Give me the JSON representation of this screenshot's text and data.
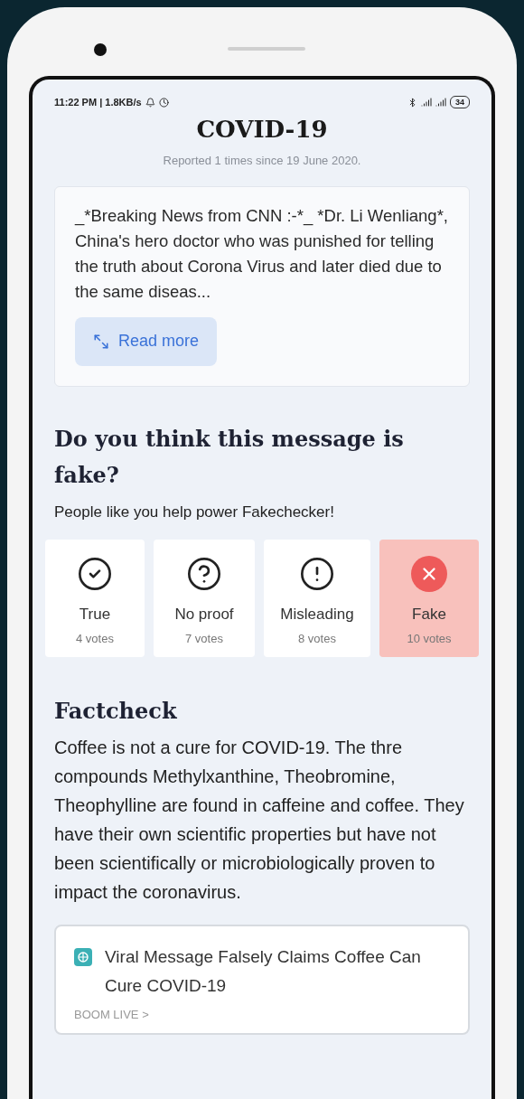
{
  "status_bar": {
    "time": "11:22 PM | 1.8KB/s",
    "battery": "34"
  },
  "title": "COVID-19",
  "reported": "Reported 1 times since 19 June 2020.",
  "message": {
    "text": "_*Breaking News from CNN :-*_ *Dr. Li Wenliang*, China's hero doctor who was punished for telling the truth about Corona Virus and later died due to the same diseas...",
    "button": "Read more"
  },
  "question": {
    "heading": "Do you think this message is fake?",
    "subtitle": "People like you help power Fakechecker!"
  },
  "verdicts": [
    {
      "kind": "true",
      "label": "True",
      "votes": "4 votes",
      "selected": false
    },
    {
      "kind": "no_proof",
      "label": "No proof",
      "votes": "7 votes",
      "selected": false
    },
    {
      "kind": "misleading",
      "label": "Misleading",
      "votes": "8 votes",
      "selected": false
    },
    {
      "kind": "fake",
      "label": "Fake",
      "votes": "10 votes",
      "selected": true
    }
  ],
  "factcheck": {
    "heading": "Factcheck",
    "text": "Coffee is not a cure for COVID-19. The thre compounds Methylxanthine, Theobromine, Theophylline are found in caffeine and coffee. They have their own scientific properties but have not been scientifically or microbiologically proven to impact the coronavirus."
  },
  "source_link": {
    "title": "Viral Message Falsely Claims Coffee Can Cure COVID-19",
    "source": "BOOM LIVE >"
  }
}
